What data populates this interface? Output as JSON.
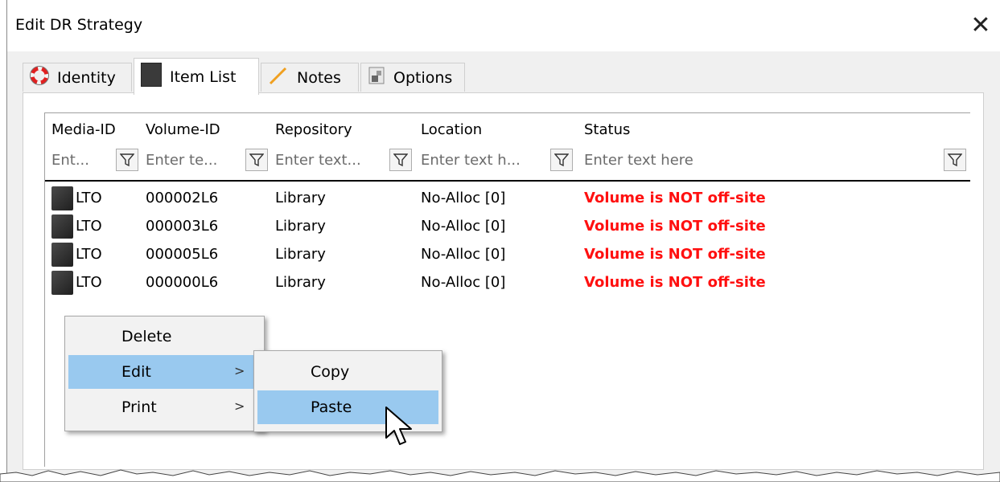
{
  "window": {
    "title": "Edit DR Strategy",
    "close_glyph": "✕"
  },
  "tabs": [
    {
      "label": "Identity",
      "icon": "lifebuoy-icon",
      "active": false
    },
    {
      "label": "Item List",
      "icon": "tape-icon",
      "active": true
    },
    {
      "label": "Notes",
      "icon": "pencil-icon",
      "active": false
    },
    {
      "label": "Options",
      "icon": "options-icon",
      "active": false
    }
  ],
  "table": {
    "columns": [
      "Media-ID",
      "Volume-ID",
      "Repository",
      "Location",
      "Status"
    ],
    "filters": [
      "Ent...",
      "Enter te...",
      "Enter text...",
      "Enter text h...",
      "Enter text here"
    ],
    "rows": [
      {
        "media": "LTO",
        "volume": "000002L6",
        "repository": "Library",
        "location": "No-Alloc [0]",
        "status": "Volume is NOT off-site"
      },
      {
        "media": "LTO",
        "volume": "000003L6",
        "repository": "Library",
        "location": "No-Alloc [0]",
        "status": "Volume is NOT off-site"
      },
      {
        "media": "LTO",
        "volume": "000005L6",
        "repository": "Library",
        "location": "No-Alloc [0]",
        "status": "Volume is NOT off-site"
      },
      {
        "media": "LTO",
        "volume": "000000L6",
        "repository": "Library",
        "location": "No-Alloc [0]",
        "status": "Volume is NOT off-site"
      }
    ]
  },
  "context_menu": {
    "items": [
      {
        "label": "Delete",
        "submenu": false
      },
      {
        "label": "Edit",
        "submenu": true,
        "highlighted": true
      },
      {
        "label": "Print",
        "submenu": true
      }
    ],
    "arrow_glyph": ">"
  },
  "submenu": {
    "items": [
      {
        "label": "Copy"
      },
      {
        "label": "Paste",
        "highlighted": true
      }
    ]
  },
  "colors": {
    "status": "#ff1010",
    "highlight": "#99c9ef"
  }
}
